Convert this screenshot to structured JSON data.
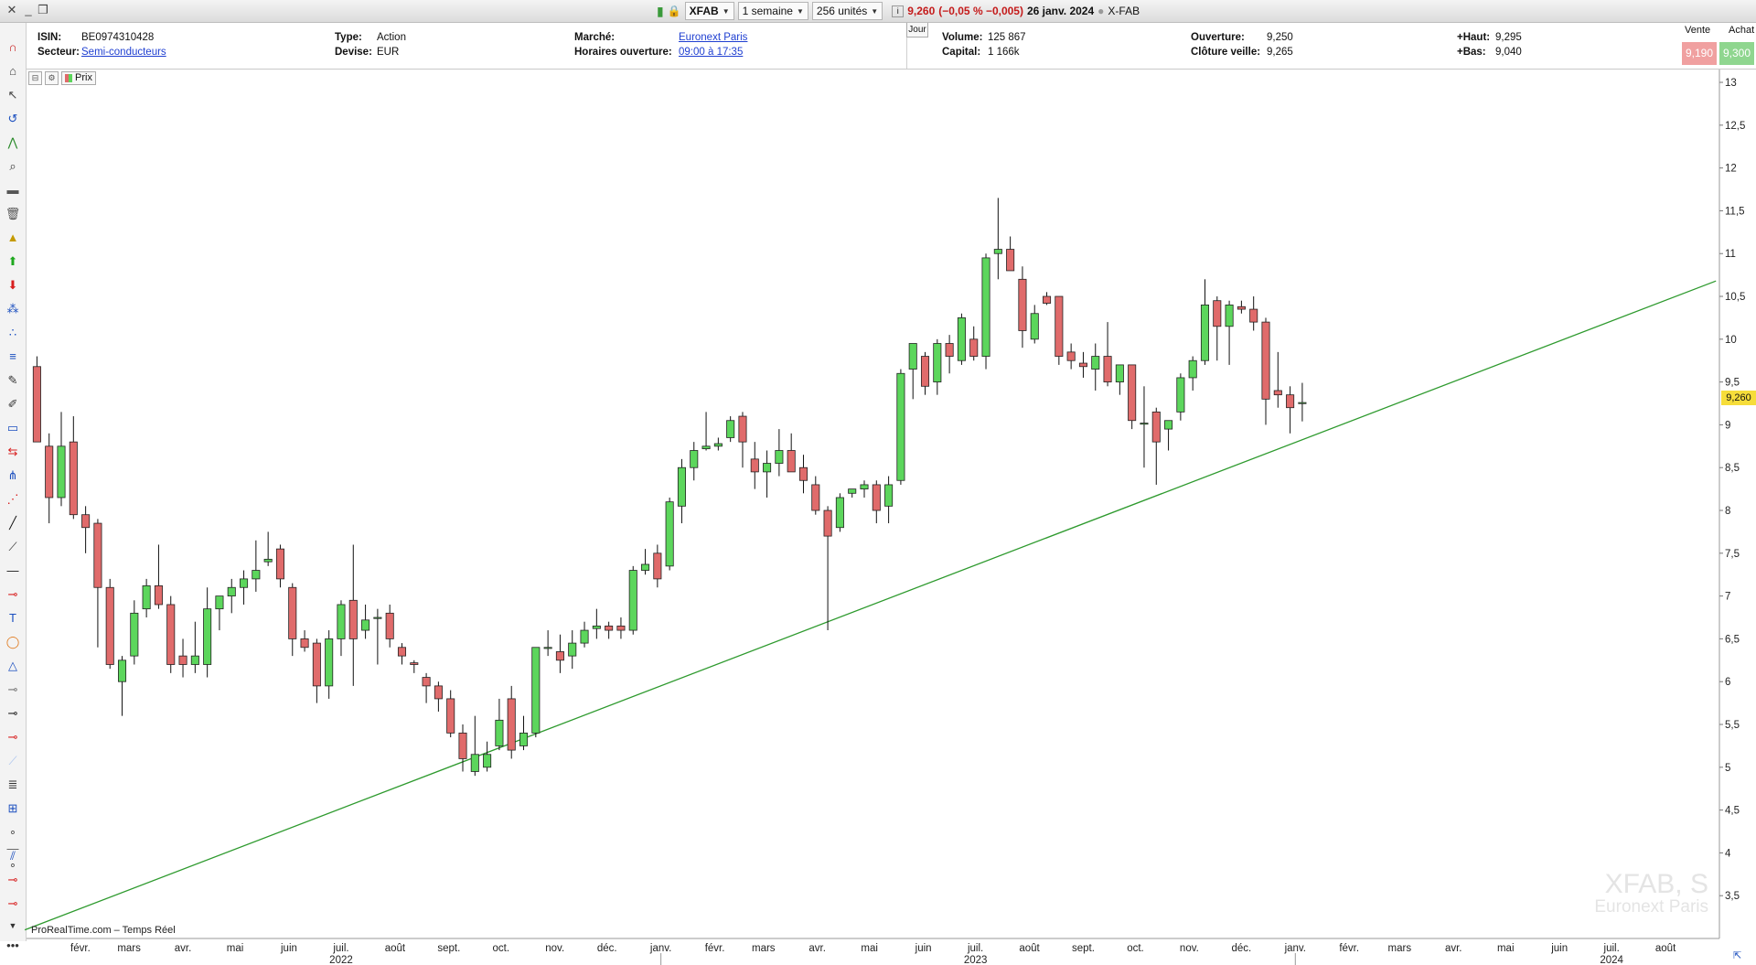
{
  "titlebar": {
    "ticker": "XFAB",
    "period": "1 semaine",
    "units": "256 unités",
    "price": "9,260",
    "change": "(−0,05 % −0,005)",
    "date": "26 janv. 2024",
    "symbol": "X-FAB"
  },
  "info": {
    "isin_label": "ISIN:",
    "isin": "BE0974310428",
    "secteur_label": "Secteur:",
    "secteur": "Semi-conducteurs",
    "type_label": "Type:",
    "type": "Action",
    "devise_label": "Devise:",
    "devise": "EUR",
    "marche_label": "Marché:",
    "marche": "Euronext Paris",
    "horaires_label": "Horaires ouverture:",
    "horaires": "09:00 à 17:35",
    "jour": "Jour",
    "volume_label": "Volume:",
    "volume": "125 867",
    "capital_label": "Capital:",
    "capital": "1 166k",
    "ouverture_label": "Ouverture:",
    "ouverture": "9,250",
    "cloture_label": "Clôture veille:",
    "cloture": "9,265",
    "haut_label": "+Haut:",
    "haut": "9,295",
    "bas_label": "+Bas:",
    "bas": "9,040",
    "vente_label": "Vente",
    "vente": "9,190",
    "achat_label": "Achat",
    "achat": "9,300"
  },
  "legend": {
    "label": "Prix"
  },
  "footer": {
    "source": "ProRealTime.com – Temps Réel"
  },
  "watermark": {
    "symbol": "XFAB, S",
    "market": "Euronext Paris"
  },
  "colors": {
    "up": "#5cd65c",
    "down": "#e06b6b",
    "trendline": "#2e9a2e",
    "vente": "#f0a0a0",
    "achat": "#8fd68f",
    "last": "#f6dd3a"
  },
  "chart_data": {
    "type": "candlestick",
    "timeframe": "weekly",
    "y_ticks": [
      3.5,
      4,
      4.5,
      5,
      5.5,
      6,
      6.5,
      7,
      7.5,
      8,
      8.5,
      9,
      9.5,
      10,
      10.5,
      11,
      11.5,
      12,
      12.5,
      13
    ],
    "y_tick_labels": [
      "3,5",
      "4",
      "4,5",
      "5",
      "5,5",
      "6",
      "6,5",
      "7",
      "7,5",
      "8",
      "8,5",
      "9",
      "9,5",
      "10",
      "10,5",
      "11",
      "11,5",
      "12",
      "12,5",
      "13"
    ],
    "ylim": [
      3.0,
      13.15
    ],
    "x_month_ticks": [
      {
        "label": "févr.",
        "date": "2022-02-01"
      },
      {
        "label": "mars",
        "date": "2022-03-01"
      },
      {
        "label": "avr.",
        "date": "2022-04-01"
      },
      {
        "label": "mai",
        "date": "2022-05-01"
      },
      {
        "label": "juin",
        "date": "2022-06-01"
      },
      {
        "label": "juil.",
        "date": "2022-07-01"
      },
      {
        "label": "août",
        "date": "2022-08-01"
      },
      {
        "label": "sept.",
        "date": "2022-09-01"
      },
      {
        "label": "oct.",
        "date": "2022-10-01"
      },
      {
        "label": "nov.",
        "date": "2022-11-01"
      },
      {
        "label": "déc.",
        "date": "2022-12-01"
      },
      {
        "label": "janv.",
        "date": "2023-01-01"
      },
      {
        "label": "févr.",
        "date": "2023-02-01"
      },
      {
        "label": "mars",
        "date": "2023-03-01"
      },
      {
        "label": "avr.",
        "date": "2023-04-01"
      },
      {
        "label": "mai",
        "date": "2023-05-01"
      },
      {
        "label": "juin",
        "date": "2023-06-01"
      },
      {
        "label": "juil.",
        "date": "2023-07-01"
      },
      {
        "label": "août",
        "date": "2023-08-01"
      },
      {
        "label": "sept.",
        "date": "2023-09-01"
      },
      {
        "label": "oct.",
        "date": "2023-10-01"
      },
      {
        "label": "nov.",
        "date": "2023-11-01"
      },
      {
        "label": "déc.",
        "date": "2023-12-01"
      },
      {
        "label": "janv.",
        "date": "2024-01-01"
      },
      {
        "label": "févr.",
        "date": "2024-02-01"
      },
      {
        "label": "mars",
        "date": "2024-03-01"
      },
      {
        "label": "avr.",
        "date": "2024-04-01"
      },
      {
        "label": "mai",
        "date": "2024-05-01"
      },
      {
        "label": "juin",
        "date": "2024-06-01"
      },
      {
        "label": "juil.",
        "date": "2024-07-01"
      },
      {
        "label": "août",
        "date": "2024-08-01"
      }
    ],
    "x_year_ticks": [
      {
        "label": "2022",
        "date": "2022-07-01"
      },
      {
        "label": "2023",
        "date": "2023-07-01"
      },
      {
        "label": "2024",
        "date": "2024-07-01"
      }
    ],
    "last_price": "9,260",
    "candles": [
      {
        "o": 9.68,
        "h": 9.8,
        "l": 8.85,
        "c": 8.8
      },
      {
        "o": 8.75,
        "h": 8.9,
        "l": 7.85,
        "c": 8.15
      },
      {
        "o": 8.15,
        "h": 9.15,
        "l": 8.05,
        "c": 8.75
      },
      {
        "o": 8.8,
        "h": 9.1,
        "l": 7.9,
        "c": 7.95
      },
      {
        "o": 7.95,
        "h": 8.05,
        "l": 7.5,
        "c": 7.8
      },
      {
        "o": 7.85,
        "h": 7.9,
        "l": 6.4,
        "c": 7.1
      },
      {
        "o": 7.1,
        "h": 7.2,
        "l": 6.15,
        "c": 6.2
      },
      {
        "o": 6.0,
        "h": 6.3,
        "l": 5.6,
        "c": 6.25
      },
      {
        "o": 6.3,
        "h": 6.95,
        "l": 6.2,
        "c": 6.8
      },
      {
        "o": 6.85,
        "h": 7.2,
        "l": 6.75,
        "c": 7.12
      },
      {
        "o": 7.12,
        "h": 7.6,
        "l": 6.85,
        "c": 6.9
      },
      {
        "o": 6.9,
        "h": 7.0,
        "l": 6.1,
        "c": 6.2
      },
      {
        "o": 6.3,
        "h": 6.5,
        "l": 6.05,
        "c": 6.2
      },
      {
        "o": 6.2,
        "h": 6.7,
        "l": 6.1,
        "c": 6.3
      },
      {
        "o": 6.2,
        "h": 7.1,
        "l": 6.05,
        "c": 6.85
      },
      {
        "o": 6.85,
        "h": 7.0,
        "l": 6.6,
        "c": 7.0
      },
      {
        "o": 7.0,
        "h": 7.2,
        "l": 6.8,
        "c": 7.1
      },
      {
        "o": 7.1,
        "h": 7.3,
        "l": 6.9,
        "c": 7.2
      },
      {
        "o": 7.2,
        "h": 7.65,
        "l": 7.05,
        "c": 7.3
      },
      {
        "o": 7.4,
        "h": 7.75,
        "l": 7.35,
        "c": 7.43
      },
      {
        "o": 7.55,
        "h": 7.6,
        "l": 7.1,
        "c": 7.2
      },
      {
        "o": 7.1,
        "h": 7.15,
        "l": 6.3,
        "c": 6.5
      },
      {
        "o": 6.5,
        "h": 6.6,
        "l": 6.35,
        "c": 6.4
      },
      {
        "o": 6.45,
        "h": 6.5,
        "l": 5.75,
        "c": 5.95
      },
      {
        "o": 5.95,
        "h": 6.6,
        "l": 5.8,
        "c": 6.5
      },
      {
        "o": 6.5,
        "h": 6.95,
        "l": 6.3,
        "c": 6.9
      },
      {
        "o": 6.95,
        "h": 7.6,
        "l": 5.95,
        "c": 6.5
      },
      {
        "o": 6.6,
        "h": 6.9,
        "l": 6.5,
        "c": 6.72
      },
      {
        "o": 6.75,
        "h": 6.85,
        "l": 6.2,
        "c": 6.75
      },
      {
        "o": 6.8,
        "h": 6.9,
        "l": 6.4,
        "c": 6.5
      },
      {
        "o": 6.4,
        "h": 6.45,
        "l": 6.2,
        "c": 6.3
      },
      {
        "o": 6.22,
        "h": 6.25,
        "l": 6.1,
        "c": 6.2
      },
      {
        "o": 6.05,
        "h": 6.1,
        "l": 5.75,
        "c": 5.95
      },
      {
        "o": 5.95,
        "h": 6.0,
        "l": 5.65,
        "c": 5.8
      },
      {
        "o": 5.8,
        "h": 5.9,
        "l": 5.35,
        "c": 5.4
      },
      {
        "o": 5.4,
        "h": 5.5,
        "l": 4.95,
        "c": 5.1
      },
      {
        "o": 4.95,
        "h": 5.6,
        "l": 4.9,
        "c": 5.15
      },
      {
        "o": 5.0,
        "h": 5.3,
        "l": 4.95,
        "c": 5.15
      },
      {
        "o": 5.25,
        "h": 5.8,
        "l": 5.2,
        "c": 5.55
      },
      {
        "o": 5.8,
        "h": 5.95,
        "l": 5.1,
        "c": 5.2
      },
      {
        "o": 5.25,
        "h": 5.6,
        "l": 5.2,
        "c": 5.4
      },
      {
        "o": 5.4,
        "h": 6.4,
        "l": 5.35,
        "c": 6.4
      },
      {
        "o": 6.4,
        "h": 6.6,
        "l": 6.3,
        "c": 6.4
      },
      {
        "o": 6.35,
        "h": 6.55,
        "l": 6.1,
        "c": 6.25
      },
      {
        "o": 6.3,
        "h": 6.6,
        "l": 6.15,
        "c": 6.45
      },
      {
        "o": 6.45,
        "h": 6.7,
        "l": 6.4,
        "c": 6.6
      },
      {
        "o": 6.62,
        "h": 6.85,
        "l": 6.5,
        "c": 6.65
      },
      {
        "o": 6.65,
        "h": 6.7,
        "l": 6.5,
        "c": 6.6
      },
      {
        "o": 6.65,
        "h": 6.75,
        "l": 6.5,
        "c": 6.6
      },
      {
        "o": 6.6,
        "h": 7.35,
        "l": 6.55,
        "c": 7.3
      },
      {
        "o": 7.3,
        "h": 7.55,
        "l": 7.25,
        "c": 7.37
      },
      {
        "o": 7.5,
        "h": 7.6,
        "l": 7.1,
        "c": 7.2
      },
      {
        "o": 7.35,
        "h": 8.15,
        "l": 7.3,
        "c": 8.1
      },
      {
        "o": 8.05,
        "h": 8.6,
        "l": 7.85,
        "c": 8.5
      },
      {
        "o": 8.5,
        "h": 8.8,
        "l": 8.35,
        "c": 8.7
      },
      {
        "o": 8.72,
        "h": 9.15,
        "l": 8.7,
        "c": 8.75
      },
      {
        "o": 8.75,
        "h": 8.85,
        "l": 8.7,
        "c": 8.78
      },
      {
        "o": 8.85,
        "h": 9.1,
        "l": 8.8,
        "c": 9.05
      },
      {
        "o": 9.1,
        "h": 9.15,
        "l": 8.5,
        "c": 8.8
      },
      {
        "o": 8.6,
        "h": 8.8,
        "l": 8.25,
        "c": 8.45
      },
      {
        "o": 8.45,
        "h": 8.7,
        "l": 8.15,
        "c": 8.55
      },
      {
        "o": 8.55,
        "h": 8.95,
        "l": 8.4,
        "c": 8.7
      },
      {
        "o": 8.7,
        "h": 8.9,
        "l": 8.45,
        "c": 8.45
      },
      {
        "o": 8.5,
        "h": 8.65,
        "l": 8.2,
        "c": 8.35
      },
      {
        "o": 8.3,
        "h": 8.4,
        "l": 7.95,
        "c": 8.0
      },
      {
        "o": 8.0,
        "h": 8.05,
        "l": 6.6,
        "c": 7.7
      },
      {
        "o": 7.8,
        "h": 8.2,
        "l": 7.75,
        "c": 8.15
      },
      {
        "o": 8.2,
        "h": 8.25,
        "l": 8.15,
        "c": 8.25
      },
      {
        "o": 8.25,
        "h": 8.35,
        "l": 8.15,
        "c": 8.3
      },
      {
        "o": 8.3,
        "h": 8.35,
        "l": 7.85,
        "c": 8.0
      },
      {
        "o": 8.05,
        "h": 8.4,
        "l": 7.85,
        "c": 8.3
      },
      {
        "o": 8.35,
        "h": 9.65,
        "l": 8.3,
        "c": 9.6
      },
      {
        "o": 9.65,
        "h": 9.85,
        "l": 9.3,
        "c": 9.95
      },
      {
        "o": 9.8,
        "h": 9.85,
        "l": 9.35,
        "c": 9.45
      },
      {
        "o": 9.5,
        "h": 10.0,
        "l": 9.35,
        "c": 9.95
      },
      {
        "o": 9.95,
        "h": 10.05,
        "l": 9.6,
        "c": 9.8
      },
      {
        "o": 9.75,
        "h": 10.3,
        "l": 9.7,
        "c": 10.25
      },
      {
        "o": 10.0,
        "h": 10.15,
        "l": 9.75,
        "c": 9.8
      },
      {
        "o": 9.8,
        "h": 11.0,
        "l": 9.65,
        "c": 10.95
      },
      {
        "o": 11.0,
        "h": 11.65,
        "l": 10.7,
        "c": 11.05
      },
      {
        "o": 11.05,
        "h": 11.2,
        "l": 10.8,
        "c": 10.8
      },
      {
        "o": 10.7,
        "h": 10.85,
        "l": 9.9,
        "c": 10.1
      },
      {
        "o": 10.0,
        "h": 10.4,
        "l": 9.95,
        "c": 10.3
      },
      {
        "o": 10.5,
        "h": 10.55,
        "l": 10.4,
        "c": 10.42
      },
      {
        "o": 10.5,
        "h": 10.5,
        "l": 9.7,
        "c": 9.8
      },
      {
        "o": 9.85,
        "h": 9.95,
        "l": 9.65,
        "c": 9.75
      },
      {
        "o": 9.72,
        "h": 9.85,
        "l": 9.55,
        "c": 9.68
      },
      {
        "o": 9.65,
        "h": 9.95,
        "l": 9.4,
        "c": 9.8
      },
      {
        "o": 9.8,
        "h": 10.2,
        "l": 9.45,
        "c": 9.5
      },
      {
        "o": 9.5,
        "h": 9.7,
        "l": 9.35,
        "c": 9.7
      },
      {
        "o": 9.7,
        "h": 9.7,
        "l": 8.95,
        "c": 9.05
      },
      {
        "o": 9.02,
        "h": 9.45,
        "l": 8.5,
        "c": 9.02
      },
      {
        "o": 9.15,
        "h": 9.2,
        "l": 8.3,
        "c": 8.8
      },
      {
        "o": 8.95,
        "h": 9.0,
        "l": 8.7,
        "c": 9.05
      },
      {
        "o": 9.15,
        "h": 9.6,
        "l": 9.05,
        "c": 9.55
      },
      {
        "o": 9.55,
        "h": 9.8,
        "l": 9.4,
        "c": 9.75
      },
      {
        "o": 9.75,
        "h": 10.7,
        "l": 9.7,
        "c": 10.4
      },
      {
        "o": 10.45,
        "h": 10.5,
        "l": 9.75,
        "c": 10.15
      },
      {
        "o": 10.15,
        "h": 10.45,
        "l": 9.7,
        "c": 10.4
      },
      {
        "o": 10.38,
        "h": 10.45,
        "l": 10.3,
        "c": 10.35
      },
      {
        "o": 10.35,
        "h": 10.5,
        "l": 10.1,
        "c": 10.2
      },
      {
        "o": 10.2,
        "h": 10.25,
        "l": 9.0,
        "c": 9.3
      },
      {
        "o": 9.4,
        "h": 9.85,
        "l": 9.2,
        "c": 9.35
      },
      {
        "o": 9.35,
        "h": 9.45,
        "l": 8.9,
        "c": 9.2
      },
      {
        "o": 9.25,
        "h": 9.49,
        "l": 9.04,
        "c": 9.26
      }
    ],
    "trendline": {
      "start": {
        "date": "2021-12-31",
        "price": 3.1
      },
      "end": {
        "date": "2024-08-30",
        "price": 10.68
      }
    }
  }
}
